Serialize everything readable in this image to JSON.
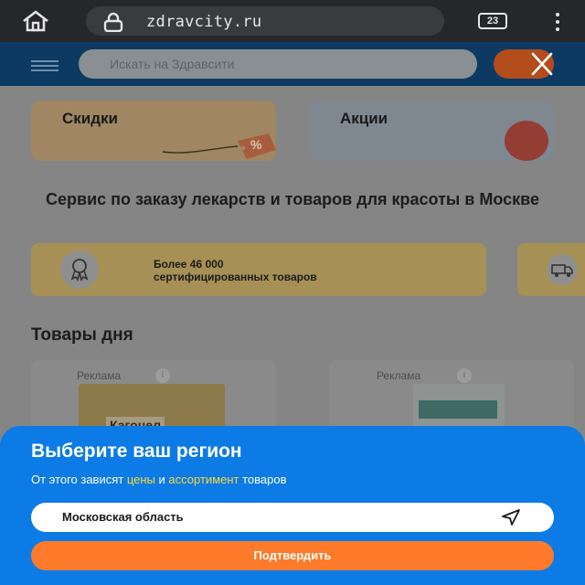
{
  "browser": {
    "url": "zdravcity.ru",
    "tab_count": "23",
    "icons": [
      "home-icon",
      "lock-icon",
      "tabs-icon",
      "kebab-menu-icon"
    ]
  },
  "header": {
    "search_placeholder": "Искать на Здравсити"
  },
  "promos": {
    "discounts": "Скидки",
    "actions": "Акции",
    "tag_text": "%"
  },
  "headline": "Сервис по заказу лекарств и товаров для красоты в Москве",
  "feature": {
    "line1": "Более 46 000",
    "line2": "сертифицированных товаров"
  },
  "section_title": "Товары дня",
  "products": [
    {
      "ad_label": "Реклама",
      "brand": "Кагоцел"
    },
    {
      "ad_label": "Реклама"
    }
  ],
  "region_sheet": {
    "title": "Выберите ваш регион",
    "subtitle_prefix": "От этого зависят ",
    "subtitle_prices": "цены",
    "subtitle_and": " и ",
    "subtitle_assortment": "ассортимент",
    "subtitle_suffix": " товаров",
    "region_value": "Московская область",
    "confirm_label": "Подтвердить"
  },
  "colors": {
    "sheet_bg": "#0c7be5",
    "highlight": "#ffd83a",
    "confirm_bg": "#ff7a2a",
    "header_bg": "#0d3a63"
  }
}
